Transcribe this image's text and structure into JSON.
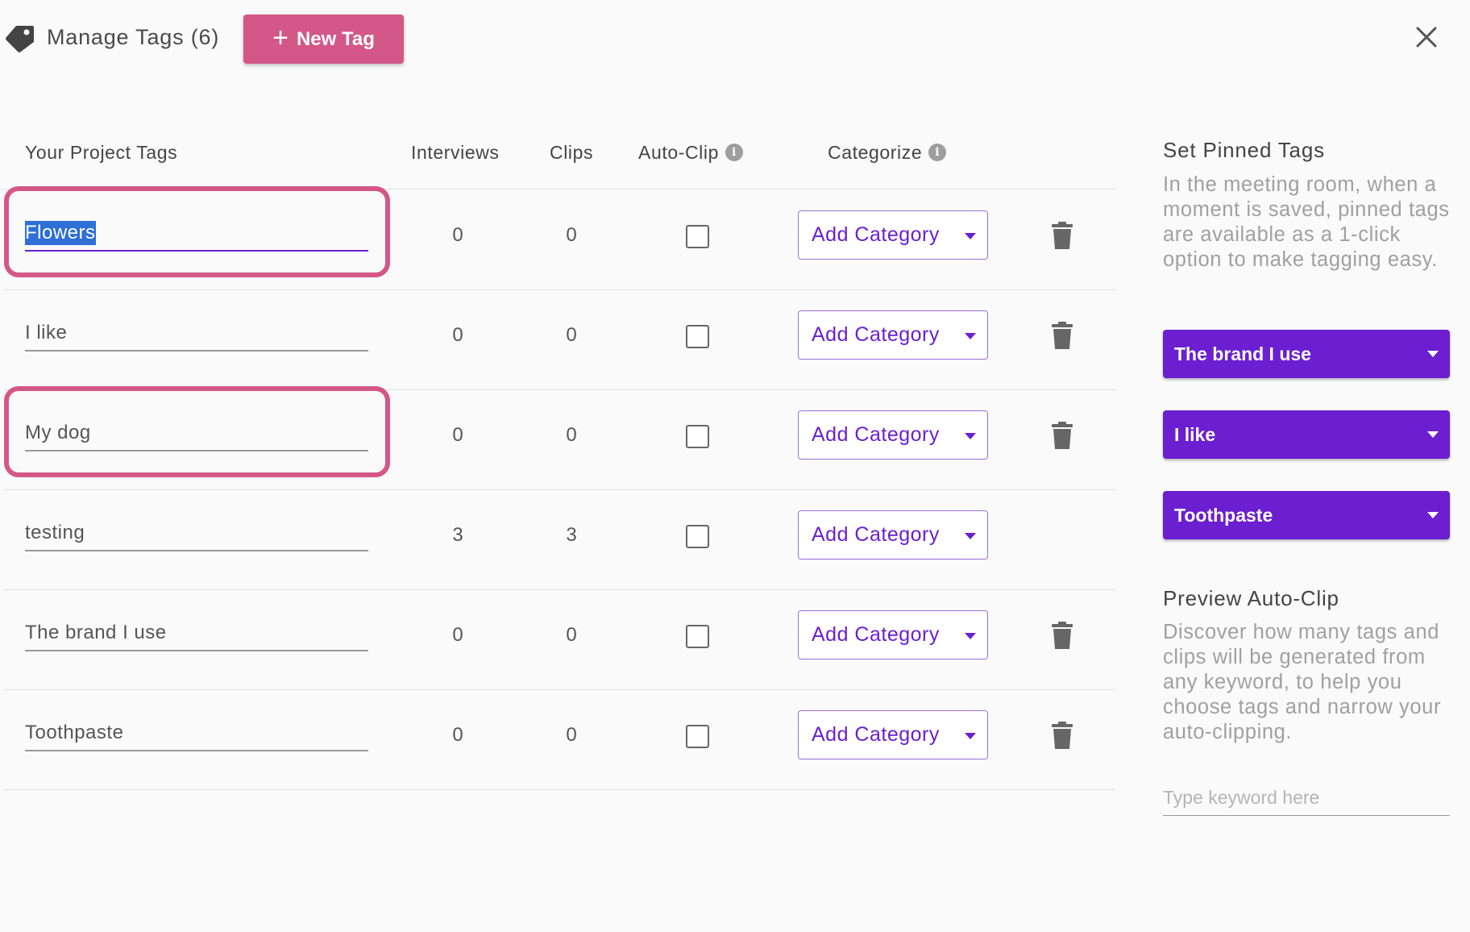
{
  "header": {
    "title": "Manage Tags (6)",
    "new_tag_label": "New Tag",
    "new_tag_icon": "plus-icon",
    "tag_icon": "tag-icon",
    "close_icon": "close-icon"
  },
  "table": {
    "columns": {
      "tags": "Your Project Tags",
      "interviews": "Interviews",
      "clips": "Clips",
      "auto_clip": "Auto-Clip",
      "categorize": "Categorize"
    },
    "rows": [
      {
        "tag": "Flowers",
        "interviews": "0",
        "clips": "0",
        "auto_clip": false,
        "category": "Add Category",
        "deletable": true,
        "highlighted": true,
        "selected": true
      },
      {
        "tag": "I like",
        "interviews": "0",
        "clips": "0",
        "auto_clip": false,
        "category": "Add Category",
        "deletable": true,
        "highlighted": false,
        "selected": false
      },
      {
        "tag": "My dog",
        "interviews": "0",
        "clips": "0",
        "auto_clip": false,
        "category": "Add Category",
        "deletable": true,
        "highlighted": true,
        "selected": false
      },
      {
        "tag": "testing",
        "interviews": "3",
        "clips": "3",
        "auto_clip": false,
        "category": "Add Category",
        "deletable": false,
        "highlighted": false,
        "selected": false
      },
      {
        "tag": "The brand I use",
        "interviews": "0",
        "clips": "0",
        "auto_clip": false,
        "category": "Add Category",
        "deletable": true,
        "highlighted": false,
        "selected": false
      },
      {
        "tag": "Toothpaste",
        "interviews": "0",
        "clips": "0",
        "auto_clip": false,
        "category": "Add Category",
        "deletable": true,
        "highlighted": false,
        "selected": false
      }
    ]
  },
  "pinned": {
    "title": "Set Pinned Tags",
    "description": "In the meeting room, when a moment is saved, pinned tags are available as a 1-click option to make tagging easy.",
    "selects": [
      "The brand I use",
      "I like",
      "Toothpaste"
    ]
  },
  "preview": {
    "title": "Preview Auto-Clip",
    "description": "Discover how many tags and clips will be generated from any keyword, to help you choose tags and narrow your auto-clipping.",
    "keyword_placeholder": "Type keyword here",
    "keyword_value": ""
  },
  "colors": {
    "accent_pink": "#d35787",
    "accent_purple": "#6b1fd1",
    "selection_blue": "#2f6fd6"
  }
}
